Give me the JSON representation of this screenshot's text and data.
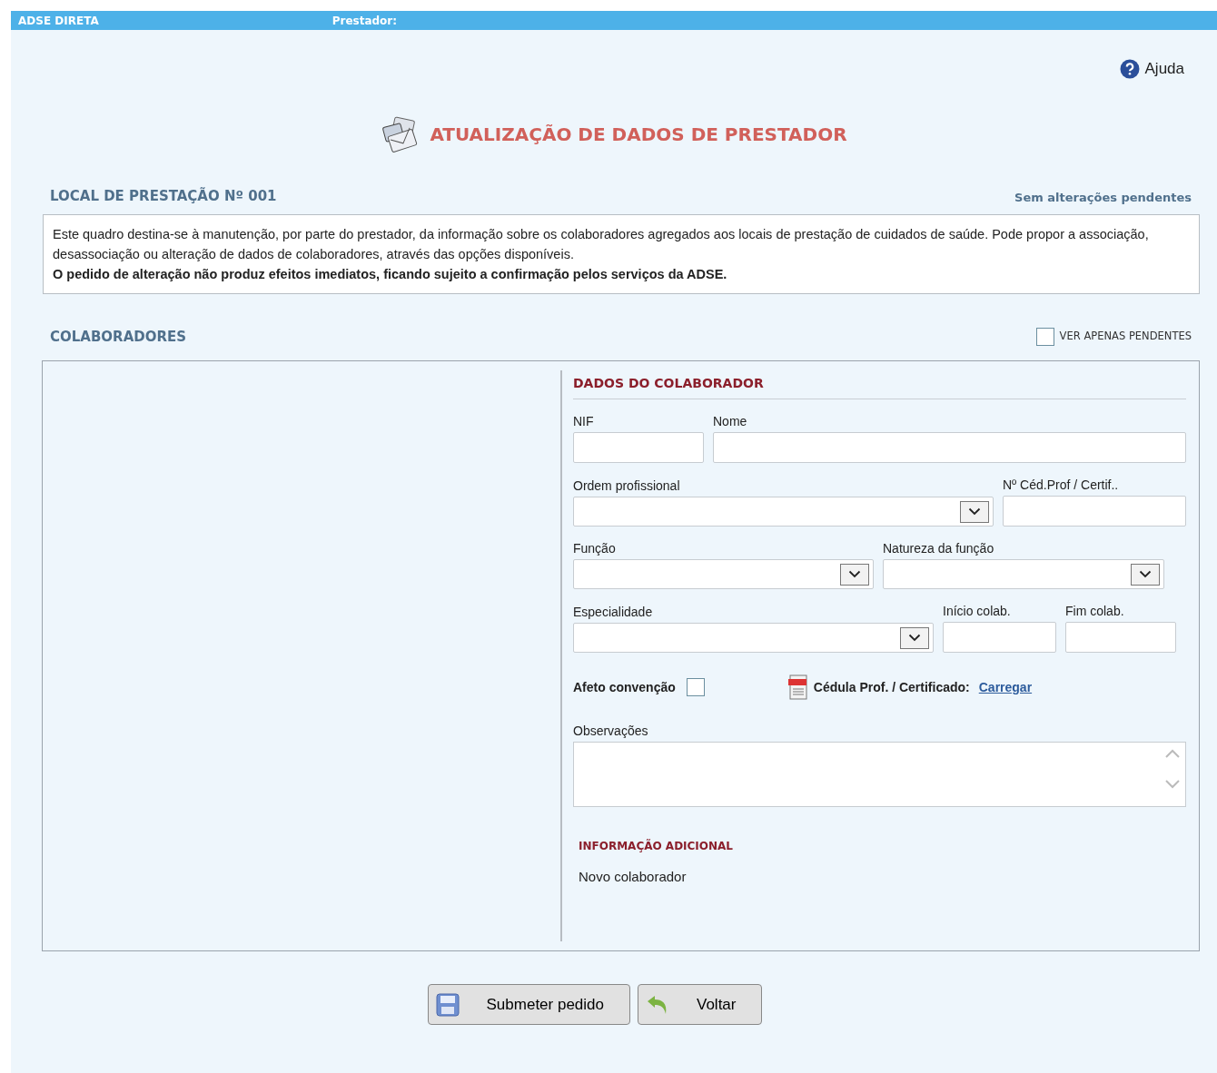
{
  "top_bar": {
    "app_name": "ADSE DIRETA",
    "provider_label": "Prestador:"
  },
  "help": {
    "label": "Ajuda"
  },
  "page_title": "ATUALIZAÇÃO DE DADOS DE PRESTADOR",
  "location": {
    "title": "LOCAL DE PRESTAÇÃO Nº 001",
    "status": "Sem alterações pendentes"
  },
  "notice": {
    "text": "Este quadro destina-se à manutenção, por parte do prestador, da informação sobre os colaboradores agregados aos locais de prestação de cuidados de saúde.  Pode propor a associação, desassociação ou alteração de dados de colaboradores, através das opções disponíveis.",
    "bold_text": "O pedido de alteração não produz efeitos imediatos, ficando sujeito a confirmação pelos serviços da ADSE."
  },
  "collaborators": {
    "title": "COLABORADORES",
    "filter": {
      "label": "VER APENAS PENDENTES",
      "checked": false
    }
  },
  "form": {
    "title": "DADOS DO COLABORADOR",
    "fields": [
      {
        "label": "NIF",
        "kind": "text"
      },
      {
        "label": "Nome",
        "kind": "text"
      },
      {
        "label": "Ordem profissional",
        "kind": "select"
      },
      {
        "label": "Nº Céd.Prof / Certif..",
        "kind": "text"
      },
      {
        "label": "Função",
        "kind": "select"
      },
      {
        "label": "Natureza da função",
        "kind": "select"
      },
      {
        "label": "Especialidade",
        "kind": "select"
      },
      {
        "label": "Início colab.",
        "kind": "text"
      },
      {
        "label": "Fim colab.",
        "kind": "text"
      }
    ],
    "agreement": {
      "label": "Afeto convenção",
      "checked": false
    },
    "certificate": {
      "label": "Cédula Prof. / Certificado:",
      "link": "Carregar"
    },
    "notes": {
      "label": "Observações"
    },
    "extra": {
      "title": "INFORMAÇÃO ADICIONAL",
      "text": "Novo colaborador"
    }
  },
  "buttons": [
    {
      "label": "Submeter pedido",
      "kind": "save"
    },
    {
      "label": "Voltar",
      "kind": "back"
    }
  ]
}
